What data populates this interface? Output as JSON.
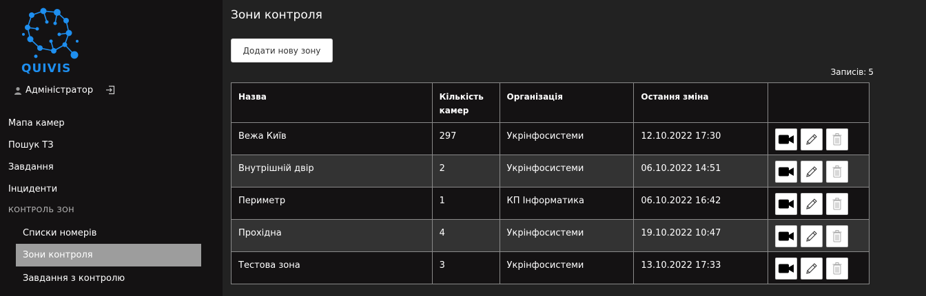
{
  "brand": {
    "name": "QUIVIS",
    "color": "#1e8ff0"
  },
  "user": {
    "name": "Адміністратор",
    "icon": "user-icon",
    "logout_icon": "logout-icon"
  },
  "nav": {
    "items": [
      {
        "label": "Мапа камер"
      },
      {
        "label": "Пошук ТЗ"
      },
      {
        "label": "Завдання"
      },
      {
        "label": "Інциденти"
      }
    ],
    "section": "КОНТРОЛЬ ЗОН",
    "sub_items": [
      {
        "label": "Списки номерів",
        "active": false
      },
      {
        "label": "Зони контроля",
        "active": true
      },
      {
        "label": "Завдання з контролю",
        "active": false
      }
    ]
  },
  "main": {
    "title": "Зони контроля",
    "add_button": "Додати нову зону",
    "records_label": "Записів:",
    "records_count": "5",
    "table": {
      "headers": [
        "Назва",
        "Кількість камер",
        "Організація",
        "Остання зміна",
        ""
      ],
      "rows": [
        {
          "name": "Вежа Київ",
          "cameras": "297",
          "org": "Укрінфосистеми",
          "changed": "12.10.2022 17:30"
        },
        {
          "name": "Внутрішній двір",
          "cameras": "2",
          "org": "Укрінфосистеми",
          "changed": "06.10.2022 14:51"
        },
        {
          "name": "Периметр",
          "cameras": "1",
          "org": "КП Інформатика",
          "changed": "06.10.2022 16:42"
        },
        {
          "name": "Прохідна",
          "cameras": "4",
          "org": "Укрінфосистеми",
          "changed": "19.10.2022 10:47"
        },
        {
          "name": "Тестова зона",
          "cameras": "3",
          "org": "Укрінфосистеми",
          "changed": "13.10.2022 17:33"
        }
      ],
      "action_icons": [
        "camera-icon",
        "pencil-icon",
        "trash-icon"
      ]
    }
  }
}
